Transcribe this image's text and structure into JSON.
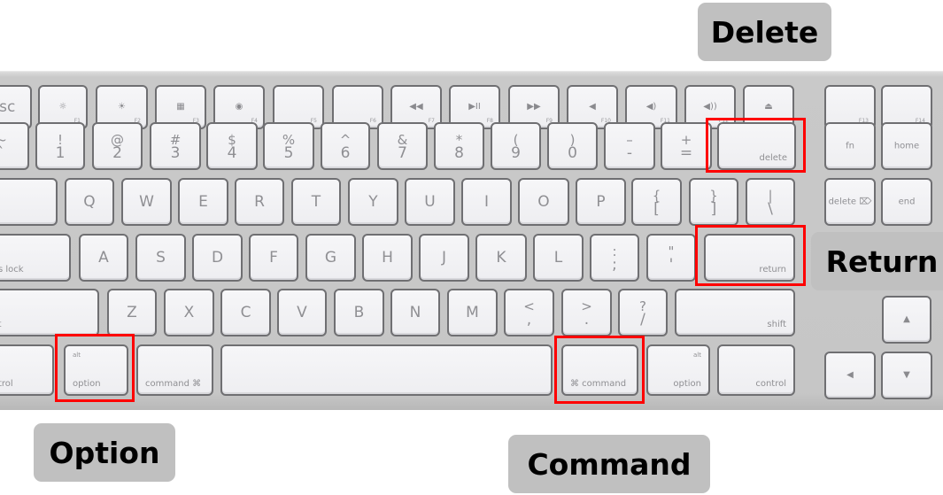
{
  "image": {
    "description": "Apple wired keyboard with highlighted Delete, Return, Option and Command keys"
  },
  "callouts": {
    "delete": "Delete",
    "return": "Return",
    "option": "Option",
    "command": "Command"
  },
  "highlight_color": "#ff0000",
  "callout_bg": "#c0c0c0",
  "keys": {
    "esc": {
      "main": "esc"
    },
    "f1": {
      "icon": "☼",
      "fn": "F1"
    },
    "f2": {
      "icon": "☀",
      "fn": "F2"
    },
    "f3": {
      "icon": "▦",
      "fn": "F3"
    },
    "f4": {
      "icon": "◉",
      "fn": "F4"
    },
    "f5": {
      "fn": "F5"
    },
    "f6": {
      "fn": "F6"
    },
    "f7": {
      "icon": "◀◀",
      "fn": "F7"
    },
    "f8": {
      "icon": "▶II",
      "fn": "F8"
    },
    "f9": {
      "icon": "▶▶",
      "fn": "F9"
    },
    "f10": {
      "icon": "◀",
      "fn": "F10"
    },
    "f11": {
      "icon": "◀)",
      "fn": "F11"
    },
    "f12": {
      "icon": "◀))",
      "fn": "F12"
    },
    "eject": {
      "icon": "⏏"
    },
    "f13": {
      "fn": "F13"
    },
    "f14": {
      "fn": "F14"
    },
    "tilde": {
      "top": "~",
      "bot": "`"
    },
    "1": {
      "top": "!",
      "bot": "1"
    },
    "2": {
      "top": "@",
      "bot": "2"
    },
    "3": {
      "top": "#",
      "bot": "3"
    },
    "4": {
      "top": "$",
      "bot": "4"
    },
    "5": {
      "top": "%",
      "bot": "5"
    },
    "6": {
      "top": "^",
      "bot": "6"
    },
    "7": {
      "top": "&",
      "bot": "7"
    },
    "8": {
      "top": "*",
      "bot": "8"
    },
    "9": {
      "top": "(",
      "bot": "9"
    },
    "0": {
      "top": ")",
      "bot": "0"
    },
    "minus": {
      "top": "–",
      "bot": "-"
    },
    "equals": {
      "top": "+",
      "bot": "="
    },
    "delete": {
      "br": "delete"
    },
    "fn": {
      "center": "fn"
    },
    "home": {
      "center": "home"
    },
    "tab": {
      "bl": ""
    },
    "q": {
      "main": "Q"
    },
    "w": {
      "main": "W"
    },
    "e": {
      "main": "E"
    },
    "r": {
      "main": "R"
    },
    "t": {
      "main": "T"
    },
    "y": {
      "main": "Y"
    },
    "u": {
      "main": "U"
    },
    "i": {
      "main": "I"
    },
    "o": {
      "main": "O"
    },
    "p": {
      "main": "P"
    },
    "lbracket": {
      "top": "{",
      "bot": "["
    },
    "rbracket": {
      "top": "}",
      "bot": "]"
    },
    "backslash": {
      "top": "|",
      "bot": "\\"
    },
    "fwd_delete": {
      "center": "delete ⌦"
    },
    "end": {
      "center": "end"
    },
    "caps": {
      "bl": "caps lock"
    },
    "a": {
      "main": "A"
    },
    "s": {
      "main": "S"
    },
    "d": {
      "main": "D"
    },
    "f": {
      "main": "F"
    },
    "g": {
      "main": "G"
    },
    "h": {
      "main": "H"
    },
    "j": {
      "main": "J"
    },
    "k": {
      "main": "K"
    },
    "l": {
      "main": "L"
    },
    "semicolon": {
      "top": ":",
      "bot": ";"
    },
    "quote": {
      "top": "\"",
      "bot": "'"
    },
    "return": {
      "br": "return"
    },
    "lshift": {
      "bl": "shift"
    },
    "z": {
      "main": "Z"
    },
    "x": {
      "main": "X"
    },
    "c": {
      "main": "C"
    },
    "v": {
      "main": "V"
    },
    "b": {
      "main": "B"
    },
    "n": {
      "main": "N"
    },
    "m": {
      "main": "M"
    },
    "comma": {
      "top": "<",
      "bot": ","
    },
    "period": {
      "top": ">",
      "bot": "."
    },
    "slash": {
      "top": "?",
      "bot": "/"
    },
    "rshift": {
      "br": "shift"
    },
    "lcontrol": {
      "bl": "control"
    },
    "loption": {
      "tl": "alt",
      "bl": "option"
    },
    "lcommand": {
      "bl": "command ⌘"
    },
    "space": {},
    "rcommand": {
      "bl": "⌘ command"
    },
    "roption": {
      "tr": "alt",
      "br": "option"
    },
    "rcontrol": {
      "br": "control"
    },
    "up": {
      "icon": "▲"
    },
    "left": {
      "icon": "◀"
    },
    "down": {
      "icon": "▼"
    }
  }
}
